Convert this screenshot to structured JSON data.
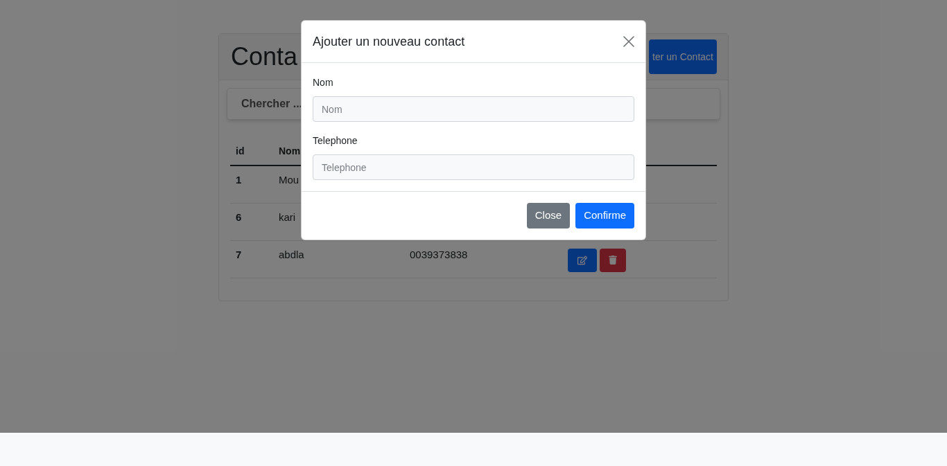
{
  "page": {
    "title": "Conta",
    "add_button": "ter un Contact",
    "search": {
      "placeholder": "Chercher ..."
    },
    "table": {
      "columns": [
        "id",
        "Nom"
      ],
      "rows": [
        {
          "id": "1",
          "nom": "Mou"
        },
        {
          "id": "6",
          "nom": "kari"
        },
        {
          "id": "7",
          "nom": "abdla",
          "telephone": "0039373838",
          "actions": [
            {
              "kind": "edit"
            },
            {
              "kind": "delete"
            }
          ]
        }
      ]
    }
  },
  "modal": {
    "title": "Ajouter un nouveau contact",
    "fields": [
      {
        "label": "Nom",
        "placeholder": "Nom"
      },
      {
        "label": "Telephone",
        "placeholder": "Telephone"
      }
    ],
    "buttons": [
      {
        "kind": "secondary",
        "label": "Close"
      },
      {
        "kind": "primary",
        "label": "Confirme"
      }
    ]
  }
}
